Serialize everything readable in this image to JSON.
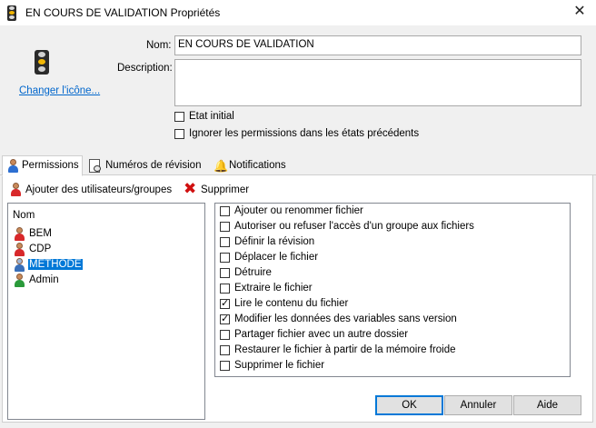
{
  "window": {
    "title": "EN COURS DE VALIDATION Propriétés",
    "close_glyph": "✕"
  },
  "icon_section": {
    "change_icon_link": "Changer l'icône..."
  },
  "form": {
    "name_label": "Nom:",
    "name_value": "EN COURS DE VALIDATION",
    "description_label": "Description:",
    "description_value": "",
    "initial_state_label": "Etat initial",
    "initial_state_checked": false,
    "ignore_permissions_label": "Ignorer les permissions dans les états précédents",
    "ignore_permissions_checked": false
  },
  "tabs": [
    {
      "label": "Permissions",
      "icon": "users-icon",
      "active": true
    },
    {
      "label": "Numéros de révision",
      "icon": "revision-icon",
      "active": false
    },
    {
      "label": "Notifications",
      "icon": "bell-icon",
      "active": false
    }
  ],
  "toolbar": {
    "add_label": "Ajouter des utilisateurs/groupes",
    "remove_label": "Supprimer"
  },
  "users": {
    "column_header": "Nom",
    "items": [
      {
        "name": "BEM",
        "type": "group",
        "selected": false
      },
      {
        "name": "CDP",
        "type": "group",
        "selected": false
      },
      {
        "name": "METHODE",
        "type": "group",
        "selected": true
      },
      {
        "name": "Admin",
        "type": "user",
        "selected": false
      }
    ]
  },
  "permissions": [
    {
      "label": "Ajouter ou renommer fichier",
      "checked": false
    },
    {
      "label": "Autoriser ou refuser l'accès d'un groupe aux fichiers",
      "checked": false
    },
    {
      "label": "Définir la révision",
      "checked": false
    },
    {
      "label": "Déplacer le fichier",
      "checked": false
    },
    {
      "label": "Détruire",
      "checked": false
    },
    {
      "label": "Extraire le fichier",
      "checked": false
    },
    {
      "label": "Lire le contenu du fichier",
      "checked": true
    },
    {
      "label": "Modifier les données des variables sans version",
      "checked": true
    },
    {
      "label": "Partager fichier avec un autre dossier",
      "checked": false
    },
    {
      "label": "Restaurer le fichier à partir de la mémoire froide",
      "checked": false
    },
    {
      "label": "Supprimer le fichier",
      "checked": false
    }
  ],
  "buttons": {
    "ok": "OK",
    "cancel": "Annuler",
    "help": "Aide"
  },
  "colors": {
    "selection": "#0078d7",
    "link": "#0066cc",
    "dialog_bg": "#f0f0f0"
  }
}
